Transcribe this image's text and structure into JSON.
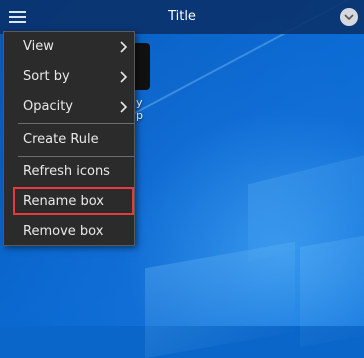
{
  "window": {
    "title": "Title"
  },
  "desktop": {
    "icon_label_partial": "y\np"
  },
  "menu": {
    "items": [
      {
        "label": "View",
        "has_submenu": true
      },
      {
        "label": "Sort by",
        "has_submenu": true
      },
      {
        "label": "Opacity",
        "has_submenu": true
      },
      {
        "label": "Create Rule",
        "has_submenu": false
      },
      {
        "label": "Refresh icons",
        "has_submenu": false
      },
      {
        "label": "Rename box",
        "has_submenu": false,
        "highlighted": true
      },
      {
        "label": "Remove box",
        "has_submenu": false
      }
    ]
  },
  "colors": {
    "highlight_border": "#e53a3f",
    "menu_background": "#2b2b2b",
    "titlebar_background": "#0a3069"
  },
  "icons": {
    "menu": "hamburger-menu-icon",
    "collapse": "chevron-down-circle-icon",
    "submenu": "chevron-right-icon"
  }
}
